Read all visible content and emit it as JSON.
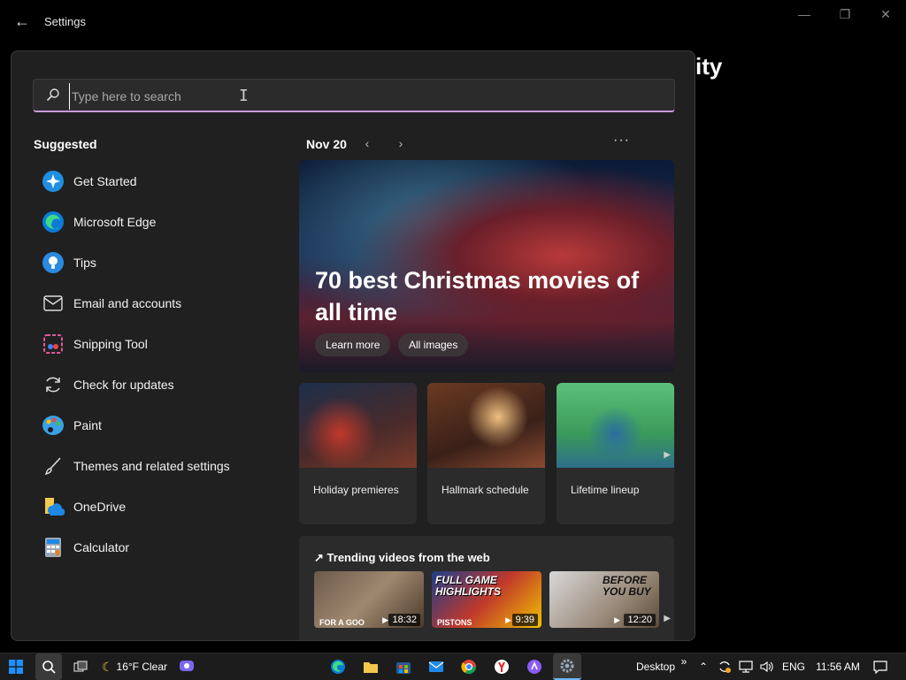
{
  "window": {
    "title": "Settings",
    "bg_heading": "ity"
  },
  "search": {
    "placeholder": "Type here to search"
  },
  "suggested": {
    "title": "Suggested",
    "items": [
      {
        "label": "Get Started",
        "icon": "get-started-icon"
      },
      {
        "label": "Microsoft Edge",
        "icon": "edge-icon"
      },
      {
        "label": "Tips",
        "icon": "tips-icon"
      },
      {
        "label": "Email and accounts",
        "icon": "mail-icon"
      },
      {
        "label": "Snipping Tool",
        "icon": "snipping-tool-icon"
      },
      {
        "label": "Check for updates",
        "icon": "refresh-icon"
      },
      {
        "label": "Paint",
        "icon": "paint-icon"
      },
      {
        "label": "Themes and related settings",
        "icon": "brush-icon"
      },
      {
        "label": "OneDrive",
        "icon": "onedrive-icon"
      },
      {
        "label": "Calculator",
        "icon": "calculator-icon"
      }
    ]
  },
  "feed": {
    "date": "Nov 20",
    "hero": {
      "title": "70 best Christmas movies of all time",
      "learn_more": "Learn more",
      "all_images": "All images"
    },
    "cards": [
      {
        "label": "Holiday premieres"
      },
      {
        "label": "Hallmark schedule"
      },
      {
        "label": "Lifetime lineup"
      }
    ],
    "trending": {
      "title": "Trending videos from the web",
      "videos": [
        {
          "duration": "18:32",
          "caption": "FOR A GOO"
        },
        {
          "duration": "9:39",
          "thumb_text": "FULL GAME HIGHLIGHTS",
          "caption": "PISTONS"
        },
        {
          "duration": "12:20",
          "thumb_text": "BEFORE YOU BUY"
        }
      ]
    }
  },
  "taskbar": {
    "weather": "16°F Clear",
    "desktop": "Desktop",
    "language": "ENG",
    "time": "11:56 AM"
  },
  "colors": {
    "panel_bg": "#202020",
    "card_bg": "#2b2b2b",
    "search_accent": "#c89ad8"
  }
}
